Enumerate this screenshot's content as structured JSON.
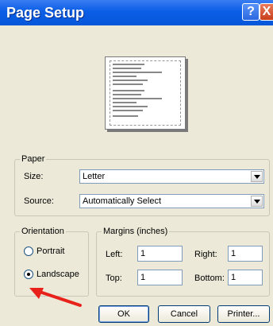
{
  "window": {
    "title": "Page Setup",
    "help_label": "?",
    "close_label": "X"
  },
  "paper": {
    "legend": "Paper",
    "size_label": "Size:",
    "size_value": "Letter",
    "source_label": "Source:",
    "source_value": "Automatically Select"
  },
  "orientation": {
    "legend": "Orientation",
    "portrait_label": "Portrait",
    "landscape_label": "Landscape",
    "selected": "Landscape"
  },
  "margins": {
    "legend": "Margins (inches)",
    "left_label": "Left:",
    "left_value": "1",
    "right_label": "Right:",
    "right_value": "1",
    "top_label": "Top:",
    "top_value": "1",
    "bottom_label": "Bottom:",
    "bottom_value": "1"
  },
  "buttons": {
    "ok": "OK",
    "cancel": "Cancel",
    "printer": "Printer..."
  },
  "colors": {
    "titlebar": "#0656d8",
    "annotation_arrow": "#e8211a"
  }
}
